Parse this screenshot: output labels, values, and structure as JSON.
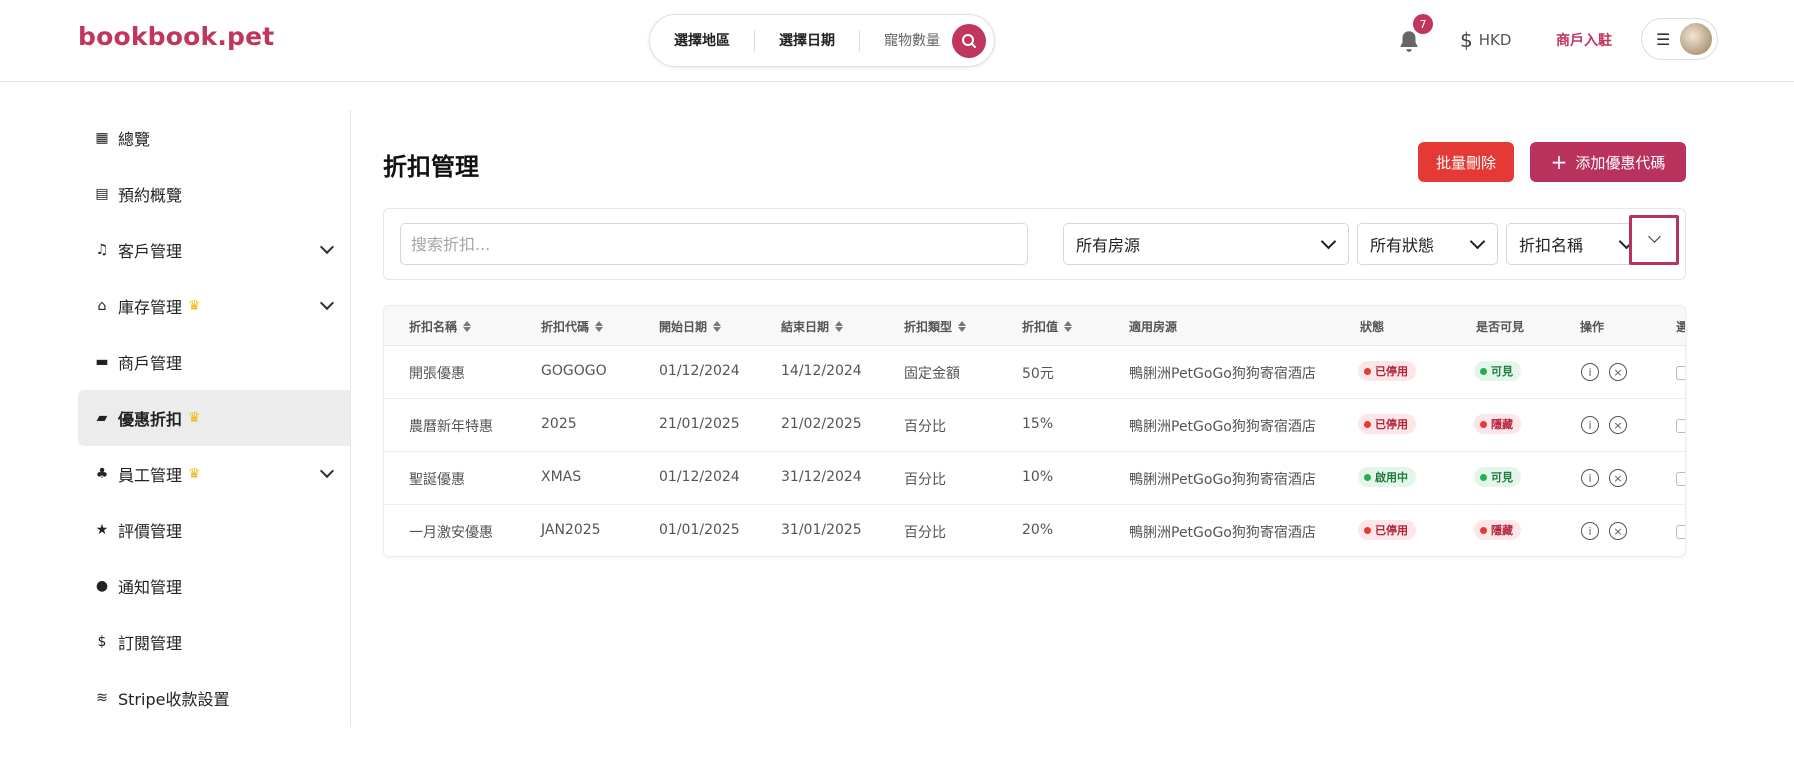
{
  "header": {
    "logo": "bookbook.pet",
    "search": {
      "region": "選擇地區",
      "date": "選擇日期",
      "pets": "寵物數量"
    },
    "notification_count": "7",
    "currency": "HKD",
    "merchant_link": "商戶入駐"
  },
  "sidebar": {
    "items": [
      {
        "label": "總覽",
        "icon": "dashboard-icon",
        "crown": false,
        "expandable": false,
        "active": false
      },
      {
        "label": "預約概覽",
        "icon": "calendar-icon",
        "crown": false,
        "expandable": false,
        "active": false
      },
      {
        "label": "客戶管理",
        "icon": "headset-icon",
        "crown": false,
        "expandable": true,
        "active": false
      },
      {
        "label": "庫存管理",
        "icon": "warehouse-icon",
        "crown": true,
        "expandable": true,
        "active": false
      },
      {
        "label": "商戶管理",
        "icon": "store-icon",
        "crown": false,
        "expandable": false,
        "active": false
      },
      {
        "label": "優惠折扣",
        "icon": "ticket-icon",
        "crown": true,
        "expandable": false,
        "active": true
      },
      {
        "label": "員工管理",
        "icon": "org-chart-icon",
        "crown": true,
        "expandable": true,
        "active": false
      },
      {
        "label": "評價管理",
        "icon": "star-icon",
        "crown": false,
        "expandable": false,
        "active": false
      },
      {
        "label": "通知管理",
        "icon": "bell-icon",
        "crown": false,
        "expandable": false,
        "active": false
      },
      {
        "label": "訂閱管理",
        "icon": "dollar-icon",
        "crown": false,
        "expandable": false,
        "active": false
      },
      {
        "label": "Stripe收款設置",
        "icon": "stripe-icon",
        "crown": false,
        "expandable": false,
        "active": false
      }
    ]
  },
  "main": {
    "title": "折扣管理",
    "bulk_delete": "批量刪除",
    "add_coupon": "添加優惠代碼",
    "filters": {
      "search_placeholder": "搜索折扣...",
      "property": "所有房源",
      "status": "所有狀態",
      "sort_by": "折扣名稱"
    },
    "table": {
      "headers": [
        "折扣名稱",
        "折扣代碼",
        "開始日期",
        "結束日期",
        "折扣類型",
        "折扣值",
        "適用房源",
        "狀態",
        "是否可見",
        "操作",
        "選"
      ],
      "rows": [
        {
          "name": "開張優惠",
          "code": "GOGOGO",
          "start": "01/12/2024",
          "end": "14/12/2024",
          "type": "固定金額",
          "value": "50元",
          "property": "鴨脷洲PetGoGo狗狗寄宿酒店",
          "status": "已停用",
          "status_color": "red",
          "visible": "可見",
          "visible_color": "green"
        },
        {
          "name": "農曆新年特惠",
          "code": "2025",
          "start": "21/01/2025",
          "end": "21/02/2025",
          "type": "百分比",
          "value": "15%",
          "property": "鴨脷洲PetGoGo狗狗寄宿酒店",
          "status": "已停用",
          "status_color": "red",
          "visible": "隱藏",
          "visible_color": "red"
        },
        {
          "name": "聖誕優惠",
          "code": "XMAS",
          "start": "01/12/2024",
          "end": "31/12/2024",
          "type": "百分比",
          "value": "10%",
          "property": "鴨脷洲PetGoGo狗狗寄宿酒店",
          "status": "啟用中",
          "status_color": "green",
          "visible": "可見",
          "visible_color": "green"
        },
        {
          "name": "一月激安優惠",
          "code": "JAN2025",
          "start": "01/01/2025",
          "end": "31/01/2025",
          "type": "百分比",
          "value": "20%",
          "property": "鴨脷洲PetGoGo狗狗寄宿酒店",
          "status": "已停用",
          "status_color": "red",
          "visible": "隱藏",
          "visible_color": "red"
        }
      ]
    }
  },
  "colors": {
    "brand": "#c0365e",
    "danger": "#e53935",
    "success": "#22b14c",
    "crown": "#f2b70c"
  }
}
